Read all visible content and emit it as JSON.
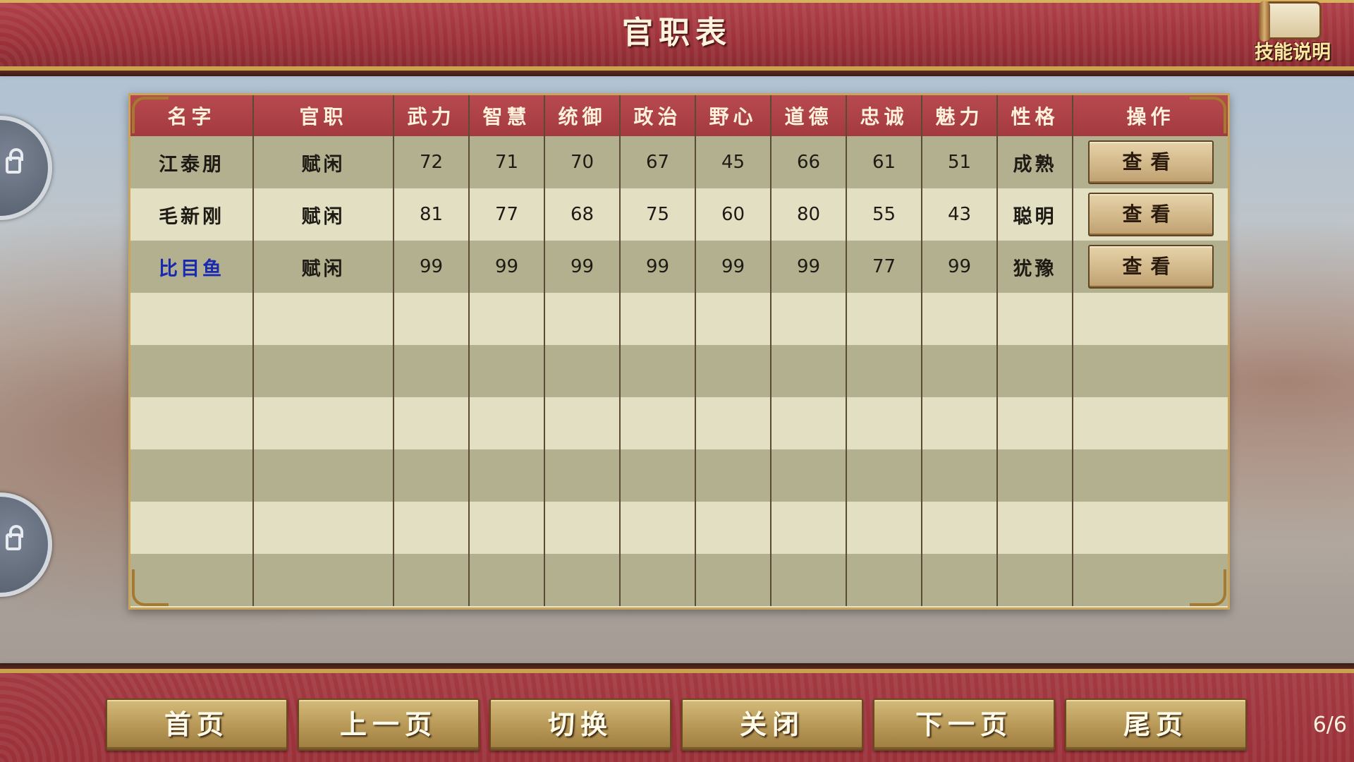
{
  "header": {
    "title": "官职表",
    "skill_button_label": "技能说明"
  },
  "table": {
    "columns": [
      "名字",
      "官职",
      "武力",
      "智慧",
      "统御",
      "政治",
      "野心",
      "道德",
      "忠诚",
      "魅力",
      "性格",
      "操作"
    ],
    "rows": [
      {
        "name": "江泰朋",
        "position": "赋闲",
        "wuli": "72",
        "zhihui": "71",
        "tongyu": "70",
        "zhengzhi": "67",
        "yexin": "45",
        "daode": "66",
        "zhongcheng": "61",
        "meili": "51",
        "xingge": "成熟",
        "action": "查看"
      },
      {
        "name": "毛新刚",
        "position": "赋闲",
        "wuli": "81",
        "zhihui": "77",
        "tongyu": "68",
        "zhengzhi": "75",
        "yexin": "60",
        "daode": "80",
        "zhongcheng": "55",
        "meili": "43",
        "xingge": "聪明",
        "action": "查看"
      },
      {
        "name": "比目鱼",
        "position": "赋闲",
        "wuli": "99",
        "zhihui": "99",
        "tongyu": "99",
        "zhengzhi": "99",
        "yexin": "99",
        "daode": "99",
        "zhongcheng": "77",
        "meili": "99",
        "xingge": "犹豫",
        "action": "查看"
      }
    ],
    "highlight_color": "#1a2ab0"
  },
  "footer": {
    "buttons": [
      "首页",
      "上一页",
      "切换",
      "关闭",
      "下一页",
      "尾页"
    ],
    "page_indicator": "6/6"
  },
  "colors": {
    "banner_red": "#a33a42",
    "gold_trim": "#c9a24e",
    "header_row": "#b74a4f",
    "row_dark": "#b3b08f",
    "row_light": "#e3dfc3"
  }
}
